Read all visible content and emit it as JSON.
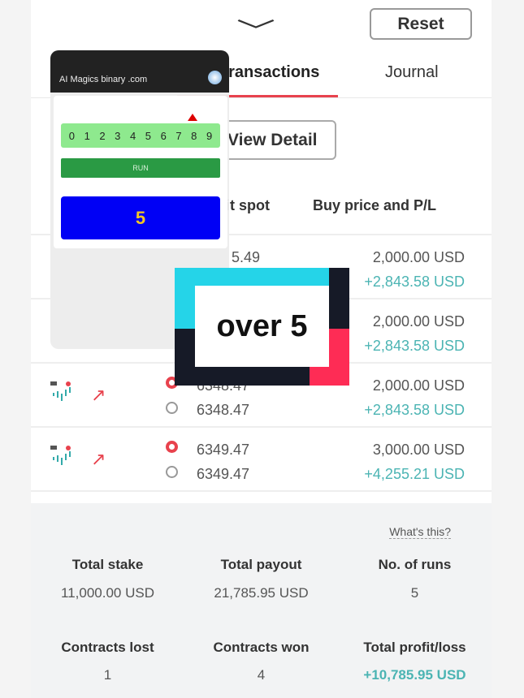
{
  "header": {
    "chevron_icon": "chevron-down",
    "reset_label": "Reset"
  },
  "tabs": [
    {
      "label": "Transactions",
      "active": true
    },
    {
      "label": "Journal"
    }
  ],
  "view_detail_label": "View Detail",
  "columns": [
    "Exit spot",
    "Buy price and P/L"
  ],
  "rows": [
    {
      "exit_top": "5.49",
      "exit_bottom": "",
      "buy": "2,000.00 USD",
      "pl": "+2,843.58 USD"
    },
    {
      "exit_top": "",
      "exit_bottom": "",
      "buy": "2,000.00 USD",
      "pl": "+2,843.58 USD"
    },
    {
      "exit_top": "6348.47",
      "exit_bottom": "6348.47",
      "buy": "2,000.00 USD",
      "pl": "+2,843.58 USD"
    },
    {
      "exit_top": "6349.47",
      "exit_bottom": "6349.47",
      "buy": "3,000.00 USD",
      "pl": "+4,255.21 USD"
    }
  ],
  "summary": {
    "whats_this": "What's this?",
    "total_stake_label": "Total stake",
    "total_stake": "11,000.00 USD",
    "total_payout_label": "Total payout",
    "total_payout": "21,785.95 USD",
    "runs_label": "No. of runs",
    "runs": "5",
    "lost_label": "Contracts lost",
    "lost": "1",
    "won_label": "Contracts won",
    "won": "4",
    "pl_label": "Total profit/loss",
    "pl": "+10,785.95 USD"
  },
  "popup": {
    "title": "AI Magics binary .com",
    "digits": [
      "0",
      "1",
      "2",
      "3",
      "4",
      "5",
      "6",
      "7",
      "8",
      "9"
    ],
    "marker_digit": "8",
    "run_label": "RUN",
    "result": "5"
  },
  "overlay_text": "over 5",
  "colors": {
    "accent": "#e8424d",
    "profit": "#4bb4b3",
    "run": "#2a9a44",
    "result_bg": "#0000f5"
  }
}
